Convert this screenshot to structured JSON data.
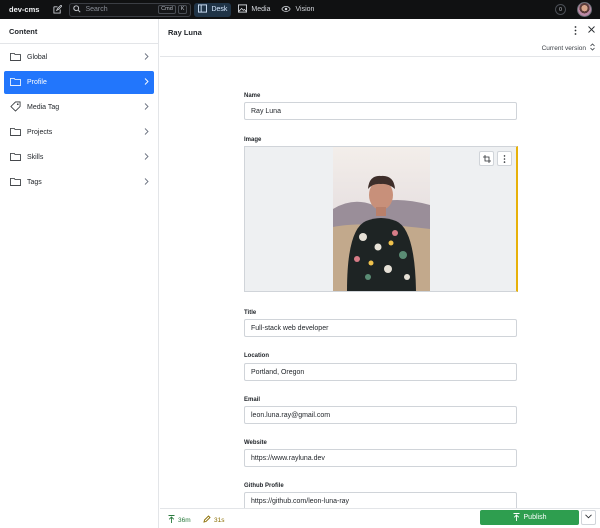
{
  "topbar": {
    "brand": "dev-cms",
    "search_placeholder": "Search",
    "kbd_cmd": "Cmd",
    "kbd_k": "K",
    "tools": [
      {
        "label": "Desk",
        "icon": "desk-icon",
        "active": true
      },
      {
        "label": "Media",
        "icon": "media-icon",
        "active": false
      },
      {
        "label": "Vision",
        "icon": "eye-icon",
        "active": false
      }
    ],
    "notification_count": "0"
  },
  "sidebar": {
    "title": "Content",
    "items": [
      {
        "label": "Global",
        "icon": "folder-icon"
      },
      {
        "label": "Profile",
        "icon": "folder-icon",
        "selected": true
      },
      {
        "label": "Media Tag",
        "icon": "tag-icon"
      },
      {
        "label": "Projects",
        "icon": "folder-icon"
      },
      {
        "label": "Skills",
        "icon": "folder-icon"
      },
      {
        "label": "Tags",
        "icon": "folder-icon"
      }
    ]
  },
  "document": {
    "title": "Ray Luna",
    "version_label": "Current version",
    "fields": {
      "name": {
        "label": "Name",
        "value": "Ray Luna"
      },
      "image": {
        "label": "Image"
      },
      "title": {
        "label": "Title",
        "value": "Full-stack web developer"
      },
      "location": {
        "label": "Location",
        "value": "Portland, Oregon"
      },
      "email": {
        "label": "Email",
        "value": "leon.luna.ray@gmail.com"
      },
      "website": {
        "label": "Website",
        "value": "https://www.rayluna.dev"
      },
      "github": {
        "label": "Github Profile",
        "value": "https://github.com/leon-luna-ray"
      }
    }
  },
  "footer": {
    "published_ago": "36m",
    "edited_ago": "31s",
    "publish_label": "Publish"
  },
  "colors": {
    "accent_blue": "#2276fc",
    "publish_green": "#2e9e4f",
    "topbar_bg": "#101112",
    "image_edge_yellow": "#e7b10a"
  }
}
